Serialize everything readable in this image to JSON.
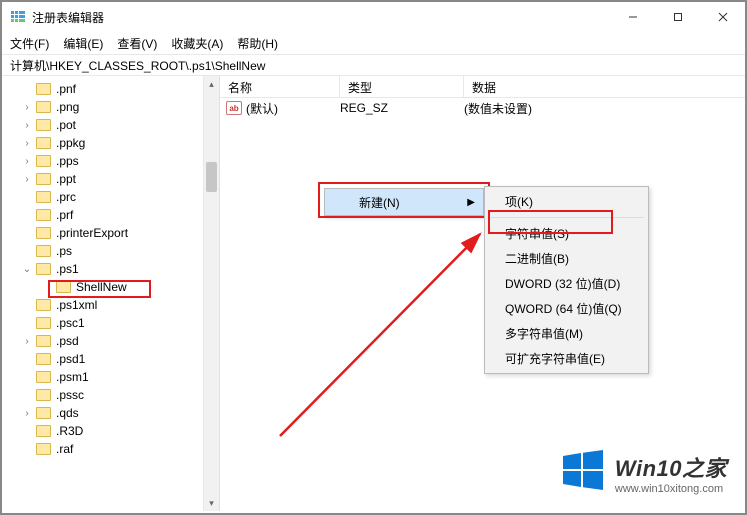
{
  "window": {
    "title": "注册表编辑器"
  },
  "menubar": {
    "file": "文件(F)",
    "edit": "编辑(E)",
    "view": "查看(V)",
    "favorites": "收藏夹(A)",
    "help": "帮助(H)"
  },
  "address": "计算机\\HKEY_CLASSES_ROOT\\.ps1\\ShellNew",
  "tree": {
    "items": [
      {
        "label": ".pnf",
        "expandable": false
      },
      {
        "label": ".png",
        "expandable": true
      },
      {
        "label": ".pot",
        "expandable": true
      },
      {
        "label": ".ppkg",
        "expandable": true
      },
      {
        "label": ".pps",
        "expandable": true
      },
      {
        "label": ".ppt",
        "expandable": true
      },
      {
        "label": ".prc",
        "expandable": false
      },
      {
        "label": ".prf",
        "expandable": false
      },
      {
        "label": ".printerExport",
        "expandable": false
      },
      {
        "label": ".ps",
        "expandable": false
      },
      {
        "label": ".ps1",
        "expandable": true,
        "expanded": true
      },
      {
        "label": "ShellNew",
        "expandable": false,
        "indent": true,
        "selected": true
      },
      {
        "label": ".ps1xml",
        "expandable": false
      },
      {
        "label": ".psc1",
        "expandable": false
      },
      {
        "label": ".psd",
        "expandable": true
      },
      {
        "label": ".psd1",
        "expandable": false
      },
      {
        "label": ".psm1",
        "expandable": false
      },
      {
        "label": ".pssc",
        "expandable": false
      },
      {
        "label": ".qds",
        "expandable": true
      },
      {
        "label": ".R3D",
        "expandable": false
      },
      {
        "label": ".raf",
        "expandable": false
      }
    ]
  },
  "list": {
    "headers": {
      "name": "名称",
      "type": "类型",
      "data": "数据"
    },
    "rows": [
      {
        "icon": "ab",
        "name": "(默认)",
        "type": "REG_SZ",
        "data": "(数值未设置)"
      }
    ]
  },
  "context_menu1": {
    "new": "新建(N)"
  },
  "context_menu2": {
    "items": [
      {
        "label": "项(K)",
        "sep_after": true
      },
      {
        "label": "字符串值(S)",
        "highlight": true
      },
      {
        "label": "二进制值(B)"
      },
      {
        "label": "DWORD (32 位)值(D)"
      },
      {
        "label": "QWORD (64 位)值(Q)"
      },
      {
        "label": "多字符串值(M)"
      },
      {
        "label": "可扩充字符串值(E)"
      }
    ]
  },
  "watermark": {
    "brand_main": "Win10",
    "brand_suffix": "之家",
    "url": "www.win10xitong.com"
  }
}
